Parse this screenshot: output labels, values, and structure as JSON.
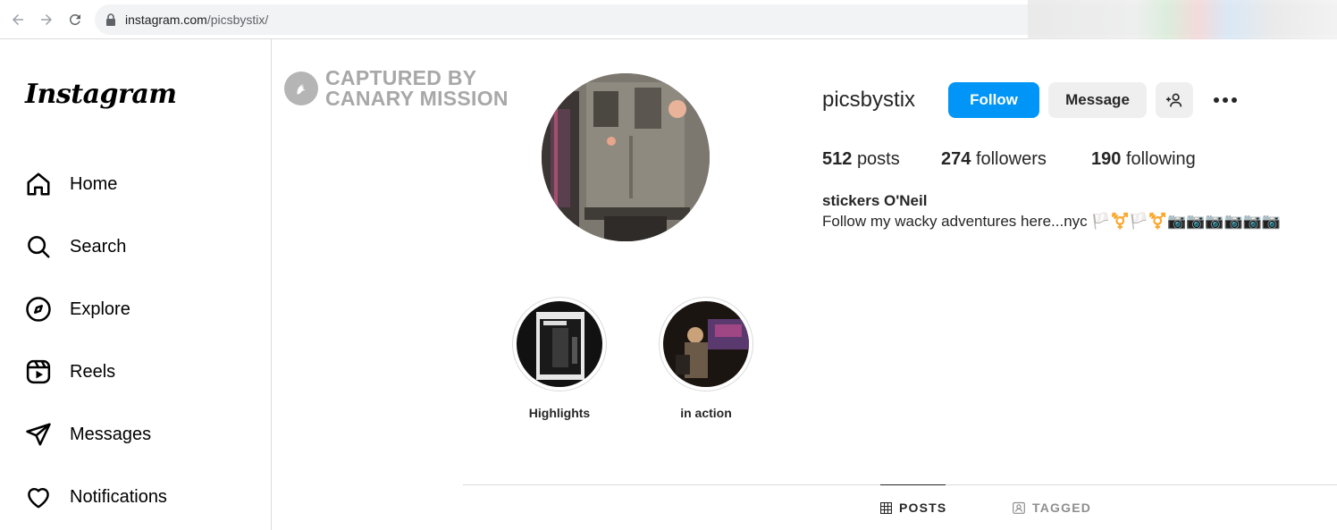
{
  "browser": {
    "url_host": "instagram.com",
    "url_path": "/picsbystix/"
  },
  "sidebar": {
    "logo": "Instagram",
    "items": [
      {
        "label": "Home",
        "icon": "home-icon"
      },
      {
        "label": "Search",
        "icon": "search-icon"
      },
      {
        "label": "Explore",
        "icon": "compass-icon"
      },
      {
        "label": "Reels",
        "icon": "reels-icon"
      },
      {
        "label": "Messages",
        "icon": "paper-plane-icon"
      },
      {
        "label": "Notifications",
        "icon": "heart-icon"
      }
    ]
  },
  "watermark": {
    "line1": "CAPTURED BY",
    "line2": "CANARY MISSION"
  },
  "profile": {
    "username": "picsbystix",
    "follow_label": "Follow",
    "message_label": "Message",
    "posts_count": "512",
    "posts_label": "posts",
    "followers_count": "274",
    "followers_label": "followers",
    "following_count": "190",
    "following_label": "following",
    "full_name": "stickers O'Neil",
    "bio": "Follow my wacky adventures here...nyc 🏳️⚧️🏳️⚧️📷📷📷📷📷📷"
  },
  "highlights": [
    {
      "label": "Highlights"
    },
    {
      "label": "in action"
    }
  ],
  "tabs": {
    "posts": "POSTS",
    "tagged": "TAGGED"
  },
  "colors": {
    "follow_button": "#0095f6",
    "secondary_button": "#efefef",
    "border": "#dbdbdb"
  }
}
